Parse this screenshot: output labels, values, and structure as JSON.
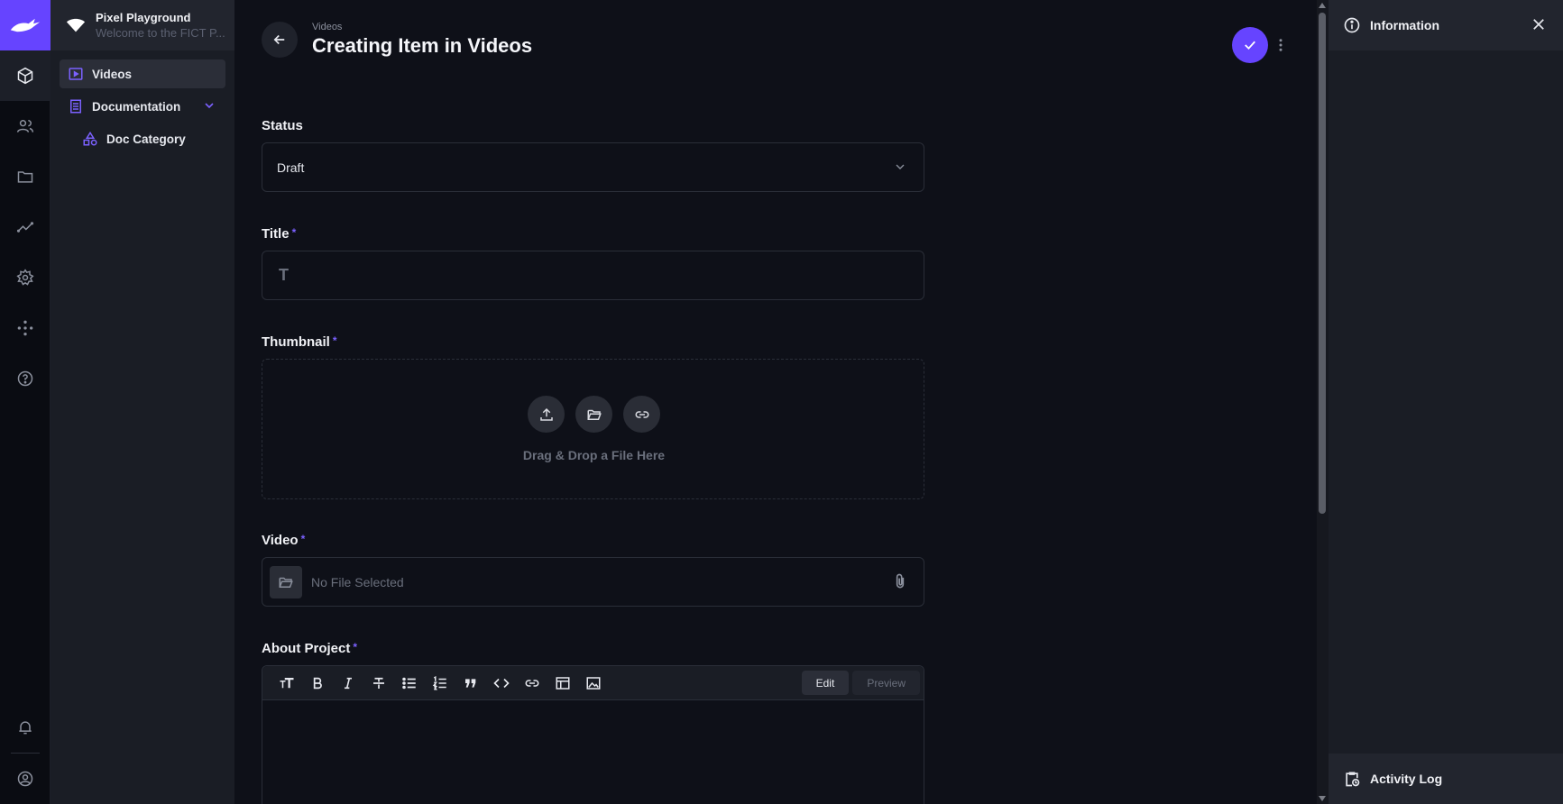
{
  "project": {
    "name": "Pixel Playground",
    "description": "Welcome to the FICT P..."
  },
  "nav": {
    "items": [
      {
        "label": "Videos"
      },
      {
        "label": "Documentation"
      },
      {
        "label": "Doc Category"
      }
    ]
  },
  "header": {
    "breadcrumb": "Videos",
    "title": "Creating Item in Videos"
  },
  "form": {
    "status": {
      "label": "Status",
      "value": "Draft"
    },
    "title": {
      "label": "Title",
      "required": "*",
      "placeholder_icon": "T"
    },
    "thumbnail": {
      "label": "Thumbnail",
      "required": "*",
      "drop_text": "Drag & Drop a File Here"
    },
    "video": {
      "label": "Video",
      "required": "*",
      "value": "No File Selected"
    },
    "about": {
      "label": "About Project",
      "required": "*",
      "edit_label": "Edit",
      "preview_label": "Preview"
    }
  },
  "info_panel": {
    "title": "Information",
    "activity_label": "Activity Log"
  },
  "colors": {
    "accent": "#6644ff",
    "background": "#0e1018",
    "panel": "#1a1d25"
  }
}
